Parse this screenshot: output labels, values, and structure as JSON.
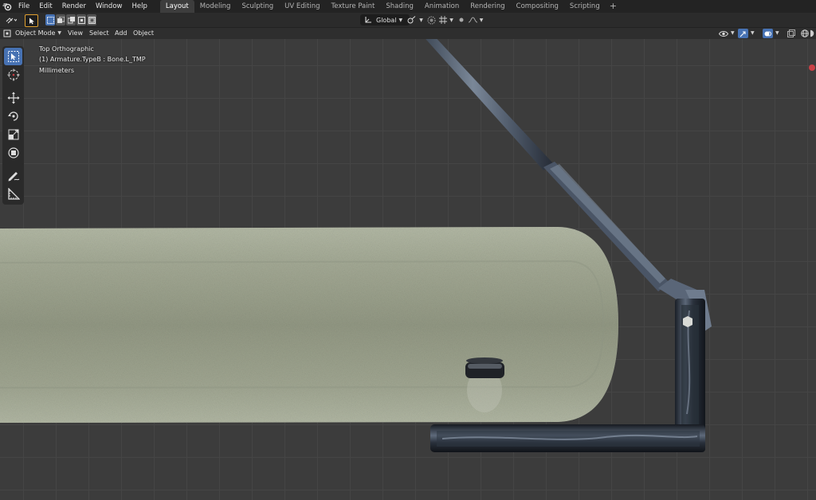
{
  "menu": {
    "items": [
      "File",
      "Edit",
      "Render",
      "Window",
      "Help"
    ]
  },
  "workspaces": {
    "tabs": [
      "Layout",
      "Modeling",
      "Sculpting",
      "UV Editing",
      "Texture Paint",
      "Shading",
      "Animation",
      "Rendering",
      "Compositing",
      "Scripting"
    ],
    "active": "Layout",
    "add_label": "+"
  },
  "tool_settings": {
    "transform_orientation": "Global"
  },
  "header": {
    "mode": "Object Mode",
    "menus": [
      "View",
      "Select",
      "Add",
      "Object"
    ]
  },
  "viewport": {
    "view_name": "Top Orthographic",
    "object_info": "(1) Armature.TypeB : Bone.L_TMP",
    "units": "Millimeters"
  },
  "toolbar": {
    "tools": [
      "select-box-icon",
      "cursor-icon",
      "move-icon",
      "rotate-icon",
      "scale-icon",
      "transform-icon",
      "annotate-icon",
      "measure-icon"
    ],
    "active": "select-box-icon"
  },
  "colors": {
    "accent": "#4772b3",
    "topbar": "#232323",
    "viewport_bg": "#3c3c3c",
    "grid": "#454545",
    "foam_body": "#9ea492",
    "metal_frame": "#2c3340"
  }
}
